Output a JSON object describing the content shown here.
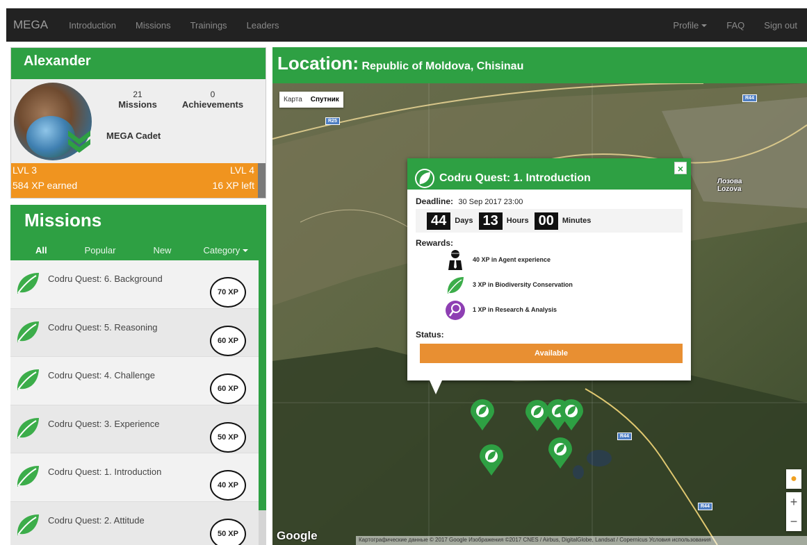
{
  "navbar": {
    "brand": "MEGA",
    "links": [
      "Introduction",
      "Missions",
      "Trainings",
      "Leaders"
    ],
    "right_links": {
      "profile": "Profile",
      "faq": "FAQ",
      "signout": "Sign out"
    }
  },
  "profile": {
    "name": "Alexander",
    "missions_count": "21",
    "missions_label": "Missions",
    "achievements_count": "0",
    "achievements_label": "Achievements",
    "rank": "MEGA Cadet",
    "level_current": "LVL 3",
    "level_next": "LVL 4",
    "xp_earned": "584 XP earned",
    "xp_left": "16 XP left",
    "xp_progress": 0.97
  },
  "missions": {
    "title": "Missions",
    "tabs": {
      "all": "All",
      "popular": "Popular",
      "new": "New",
      "category": "Category"
    },
    "items": [
      {
        "title": "Codru Quest: 6. Background",
        "xp": "70 XP"
      },
      {
        "title": "Codru Quest: 5. Reasoning",
        "xp": "60 XP"
      },
      {
        "title": "Codru Quest: 4. Challenge",
        "xp": "60 XP"
      },
      {
        "title": "Codru Quest: 3. Experience",
        "xp": "50 XP"
      },
      {
        "title": "Codru Quest: 1. Introduction",
        "xp": "40 XP"
      },
      {
        "title": "Codru Quest: 2. Attitude",
        "xp": "50 XP"
      }
    ]
  },
  "map": {
    "location_label": "Location:",
    "location_value": "Republic of Moldova, Chisinau",
    "type_map": "Карта",
    "type_satellite": "Спутник",
    "google": "Google",
    "attribution": "Картографические данные © 2017 Google Изображения ©2017 CNES / Airbus, DigitalGlobe, Landsat / Copernicus    Условия использования",
    "roads": [
      "R25",
      "R44",
      "R44",
      "R44"
    ],
    "village": [
      "Лозова",
      "Lozova"
    ],
    "zoom_in": "+",
    "zoom_out": "−",
    "colors": {
      "accent": "#2ea043",
      "orange": "#f0941f",
      "status": "#e88f32"
    }
  },
  "popup": {
    "title": "Codru Quest: 1. Introduction",
    "close": "×",
    "deadline_label": "Deadline:",
    "deadline_value": "30 Sep 2017 23:00",
    "days": "44",
    "days_label": "Days",
    "hours": "13",
    "hours_label": "Hours",
    "minutes": "00",
    "minutes_label": "Minutes",
    "rewards_label": "Rewards:",
    "rewards": [
      {
        "text": "40 XP in Agent experience",
        "icon": "agent-icon"
      },
      {
        "text": "3 XP in Biodiversity Conservation",
        "icon": "leaf-icon"
      },
      {
        "text": "1 XP in Research & Analysis",
        "icon": "magnifier-icon"
      }
    ],
    "status_label": "Status:",
    "status_value": "Available"
  }
}
